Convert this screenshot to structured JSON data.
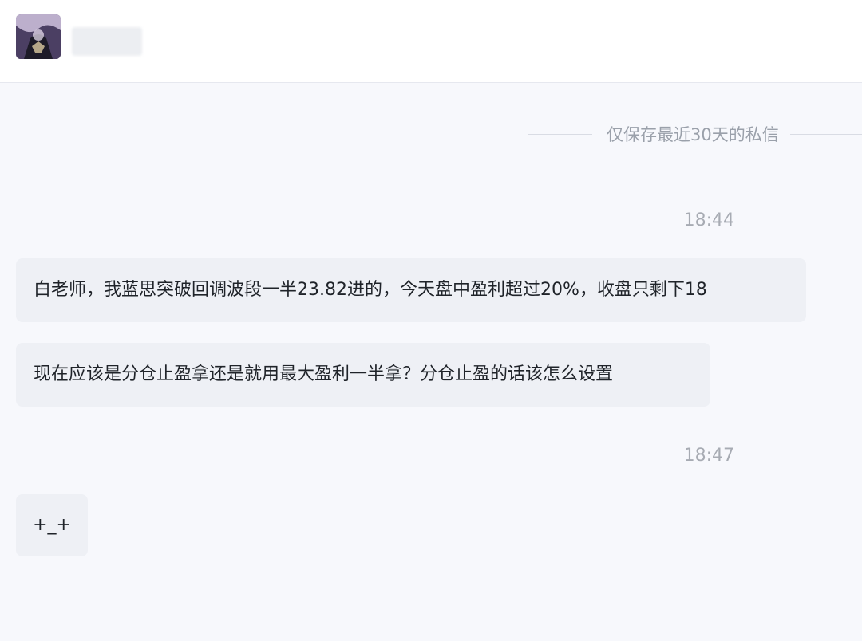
{
  "header": {
    "avatar_alt": "avatar",
    "contact_name": ""
  },
  "conversation": {
    "notice": "仅保存最近30天的私信",
    "groups": [
      {
        "time": "18:44",
        "messages": [
          "白老师，我蓝思突破回调波段一半23.82进的，今天盘中盈利超过20%，收盘只剩下18",
          "现在应该是分仓止盈拿还是就用最大盈利一半拿？分仓止盈的话该怎么设置"
        ]
      },
      {
        "time": "18:47",
        "messages": [
          "+_+"
        ]
      }
    ]
  },
  "colors": {
    "background": "#f7f8fc",
    "bubble": "#eef0f5",
    "text": "#1f2329",
    "muted": "#a7abb3"
  }
}
